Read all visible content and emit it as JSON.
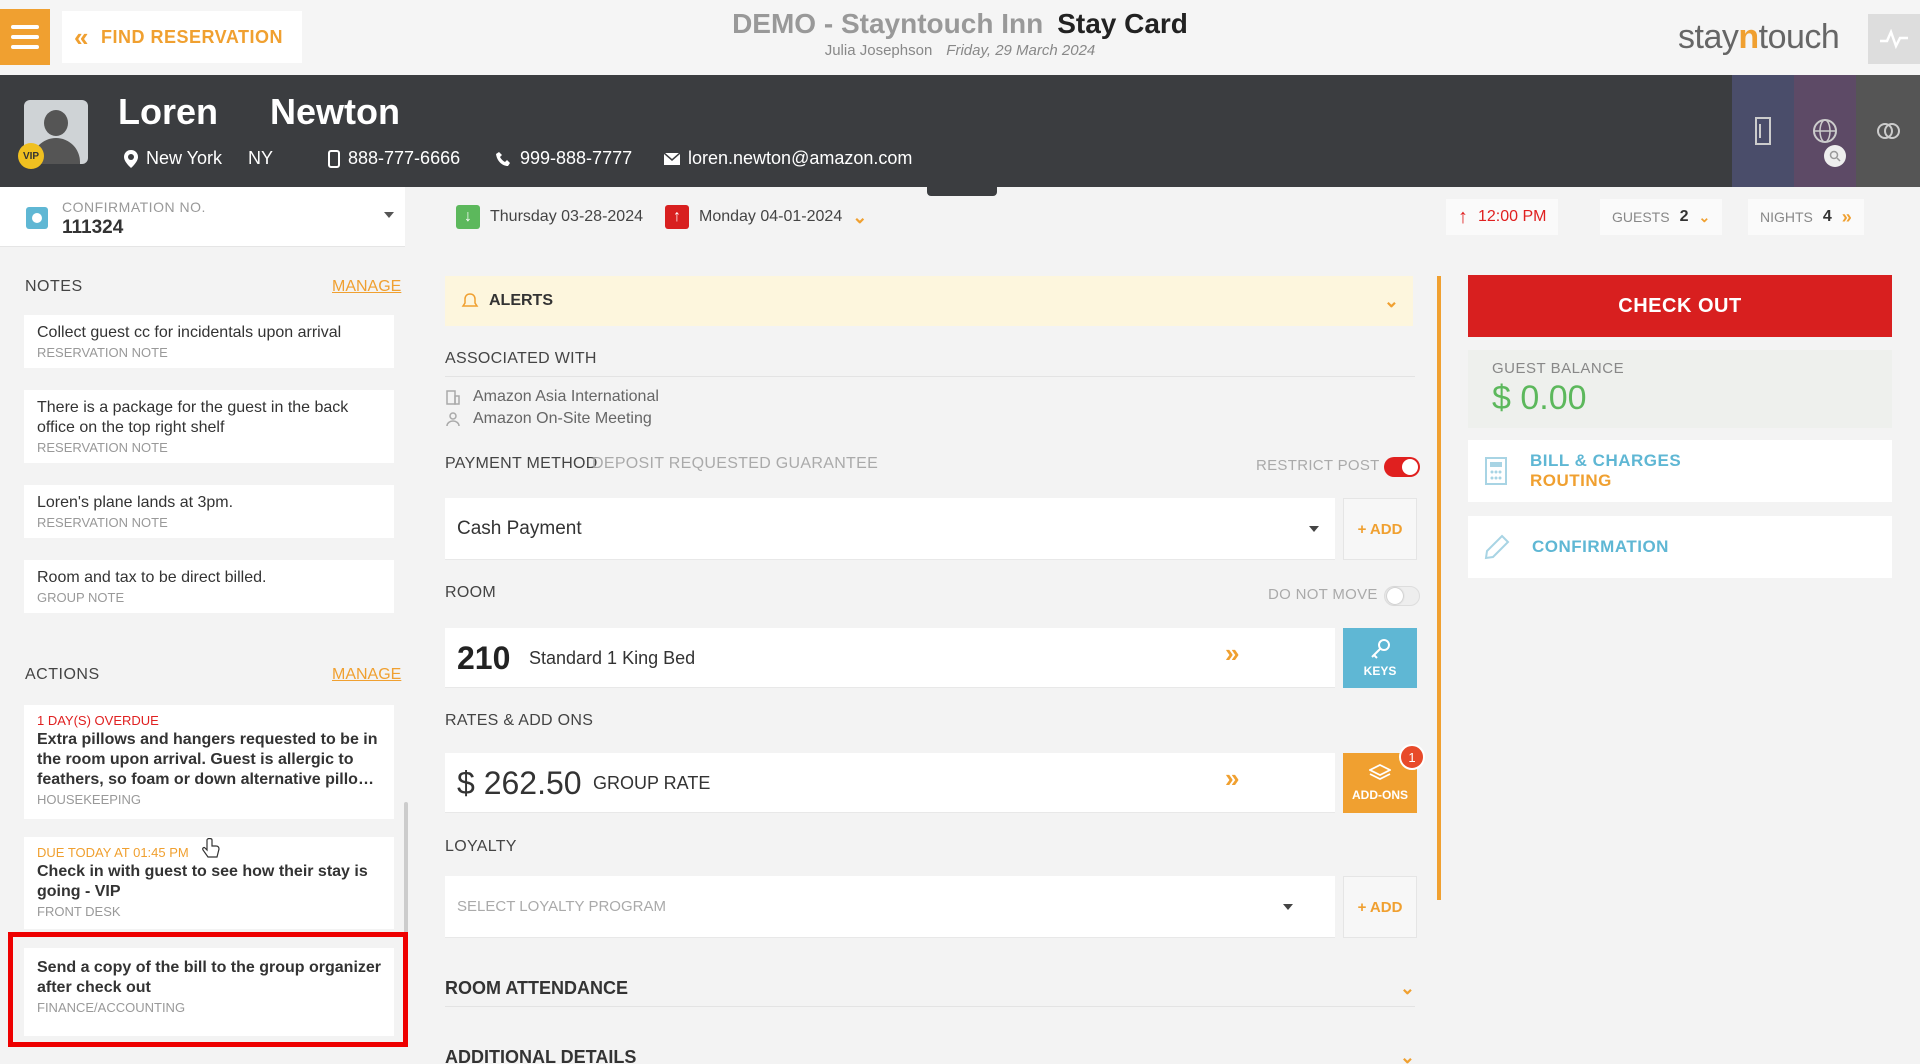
{
  "topbar": {
    "find_reservation": "FIND RESERVATION",
    "hotel": "DEMO - Stayntouch Inn",
    "page_title": "Stay Card",
    "user": "Julia Josephson",
    "date": "Friday, 29 March 2024",
    "brand_pre": "stay",
    "brand_n": "n",
    "brand_post": "touch"
  },
  "guest": {
    "first_name": "Loren",
    "last_name": "Newton",
    "vip": "VIP",
    "city": "New York",
    "state": "NY",
    "mobile": "888-777-6666",
    "phone": "999-888-7777",
    "email": "loren.newton@amazon.com"
  },
  "confirmation": {
    "label": "CONFIRMATION NO.",
    "number": "111324"
  },
  "stay": {
    "arrival": "Thursday 03-28-2024",
    "departure": "Monday 04-01-2024",
    "checkout_time": "12:00 PM",
    "guests_label": "GUESTS",
    "guests": "2",
    "nights_label": "NIGHTS",
    "nights": "4"
  },
  "notes": {
    "title": "NOTES",
    "manage": "MANAGE",
    "items": [
      {
        "text": "Collect guest cc for incidentals upon arrival",
        "tag": "RESERVATION NOTE"
      },
      {
        "text": "There is a package for the guest in the back office on the top right shelf",
        "tag": "RESERVATION NOTE"
      },
      {
        "text": "Loren's plane lands at 3pm.",
        "tag": "RESERVATION NOTE"
      },
      {
        "text": "Room and tax to be direct billed.",
        "tag": "GROUP NOTE"
      }
    ]
  },
  "actions": {
    "title": "ACTIONS",
    "manage": "MANAGE",
    "items": [
      {
        "due": "1 DAY(S) OVERDUE",
        "text": "Extra pillows and hangers requested to be in the room upon arrival. Guest is allergic to feathers, so foam or down alternative pillo…",
        "dept": "HOUSEKEEPING"
      },
      {
        "due": "DUE TODAY AT 01:45 PM",
        "text": "Check in with guest to see how their stay is going - VIP",
        "dept": "FRONT DESK"
      },
      {
        "due": "",
        "text": "Send a copy of the bill to the group organizer after check out",
        "dept": "FINANCE/ACCOUNTING"
      }
    ]
  },
  "main": {
    "alerts": "ALERTS",
    "associated_with": "ASSOCIATED WITH",
    "company": "Amazon Asia International",
    "group": "Amazon On-Site Meeting",
    "payment_method": "PAYMENT METHOD",
    "deposit_guarantee": "DEPOSIT REQUESTED GUARANTEE",
    "restrict_post": "RESTRICT POST",
    "payment_value": "Cash Payment",
    "add": "+ ADD",
    "room_label": "ROOM",
    "do_not_move": "DO NOT MOVE",
    "room_number": "210",
    "room_type": "Standard 1 King Bed",
    "keys": "KEYS",
    "rates_label": "RATES & ADD ONS",
    "rate_amount": "$ 262.50",
    "rate_name": "GROUP RATE",
    "addons": "ADD-ONS",
    "addons_count": "1",
    "loyalty_label": "LOYALTY",
    "loyalty_placeholder": "SELECT LOYALTY PROGRAM",
    "room_attendance": "ROOM ATTENDANCE",
    "additional_details": "ADDITIONAL DETAILS"
  },
  "right": {
    "check_out": "CHECK OUT",
    "guest_balance_label": "GUEST BALANCE",
    "guest_balance": "$ 0.00",
    "bill_charges": "BILL & CHARGES",
    "routing": "ROUTING",
    "confirmation": "CONFIRMATION"
  },
  "colors": {
    "accent": "#f0a030",
    "danger": "#d81f1f",
    "info": "#5fb7d4",
    "success": "#5cb85c",
    "header_dark": "#3b3d40"
  }
}
